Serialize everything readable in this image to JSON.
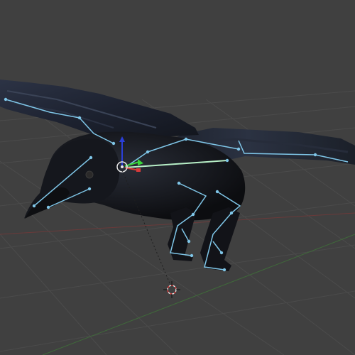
{
  "viewport": {
    "mode": "3d-view",
    "object": "crow-rigged-mesh",
    "armature_visible": true,
    "selected_bone": "head-bone",
    "transform_gizmo_axes": [
      "x",
      "y",
      "z"
    ],
    "cursor_icon": "3d-cursor-icon"
  },
  "colors": {
    "background": "#404040",
    "grid": "#4a4a4a",
    "x_axis": "#6a3a3a",
    "y_axis": "#3f6a3a",
    "bone": "#7fc6e8",
    "bone_selected": "#b8f0c8",
    "bird_body": "#1b1d24"
  },
  "bones": [
    "wing-left-bone-1",
    "wing-left-bone-2",
    "wing-left-bone-3",
    "head-bone",
    "neck-bone",
    "beak-bone-1",
    "beak-bone-2",
    "spine-bone",
    "wing-right-bone-1",
    "wing-right-bone-2",
    "wing-right-bone-3",
    "wing-right-bone-4",
    "leg-left-upper-bone",
    "leg-left-lower-bone",
    "foot-left-bone",
    "leg-right-upper-bone",
    "leg-right-lower-bone",
    "foot-right-bone"
  ]
}
